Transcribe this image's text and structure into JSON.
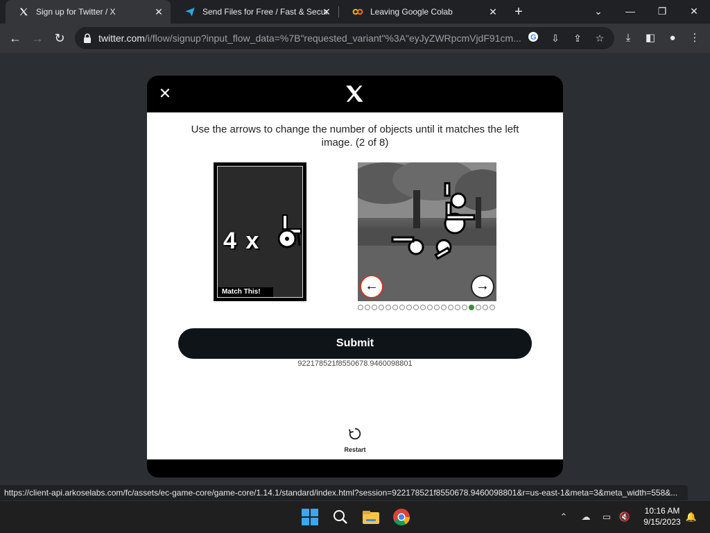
{
  "browser": {
    "tabs": [
      {
        "title": "Sign up for Twitter / X",
        "icon": "x-logo-icon",
        "active": true
      },
      {
        "title": "Send Files for Free / Fast & Secure",
        "icon": "paper-plane-icon",
        "active": false
      },
      {
        "title": "Leaving Google Colab",
        "icon": "colab-icon",
        "active": false
      }
    ],
    "url_host": "twitter.com",
    "url_path": "/i/flow/signup?input_flow_data=%7B\"requested_variant\"%3A\"eyJyZWRpcmVjdF91cm...",
    "status_url": "https://client-api.arkoselabs.com/fc/assets/ec-game-core/game-core/1.14.1/standard/index.html?session=922178521f8550678.9460098801&r=us-east-1&meta=3&meta_width=558&..."
  },
  "modal": {
    "close_glyph": "✕",
    "instruction": "Use the arrows to change the number of objects until it matches the left image. (2 of 8)",
    "reference_text": "4 x",
    "match_label": "Match This!",
    "left_arrow": "←",
    "right_arrow": "→",
    "dots_total": 20,
    "dots_active_index": 16,
    "submit_label": "Submit",
    "session_id": "922178521f8550678.9460098801",
    "restart_label": "Restart"
  },
  "taskbar": {
    "time": "10:16 AM",
    "date": "9/15/2023"
  },
  "colors": {
    "accent_active_dot": "#3b8c3b",
    "submit_bg": "#0f1419"
  }
}
